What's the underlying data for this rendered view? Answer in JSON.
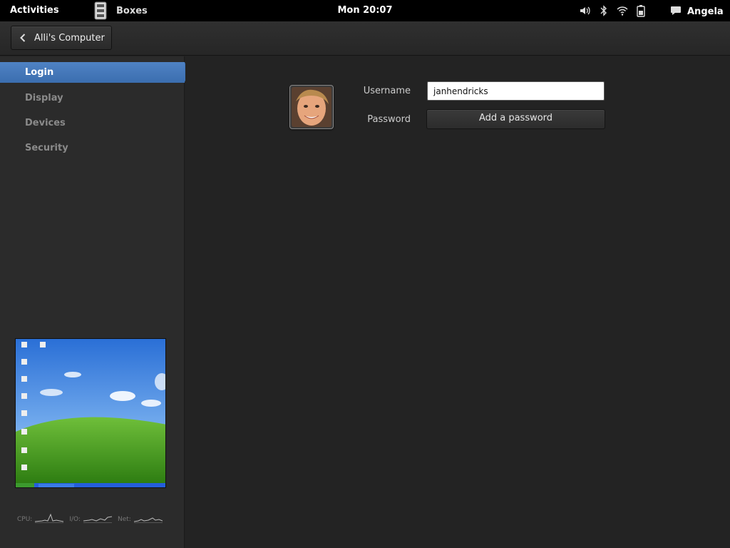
{
  "topbar": {
    "activities_label": "Activities",
    "app_name": "Boxes",
    "clock": "Mon 20:07",
    "user_name": "Angela",
    "icons": [
      "volume-icon",
      "bluetooth-icon",
      "wifi-icon",
      "battery-icon",
      "chat-icon"
    ]
  },
  "header": {
    "back_label": "Alli's Computer"
  },
  "sidebar": {
    "items": [
      {
        "label": "Login",
        "active": true
      },
      {
        "label": "Display",
        "active": false
      },
      {
        "label": "Devices",
        "active": false
      },
      {
        "label": "Security",
        "active": false
      }
    ],
    "stats": {
      "cpu_label": "CPU:",
      "io_label": "I/O:",
      "net_label": "Net:"
    }
  },
  "login": {
    "username_label": "Username",
    "username_value": "janhendricks",
    "password_label": "Password",
    "add_password_label": "Add a password"
  },
  "colors": {
    "accent": "#3d72b4",
    "background": "#232323",
    "topbar": "#000000"
  }
}
